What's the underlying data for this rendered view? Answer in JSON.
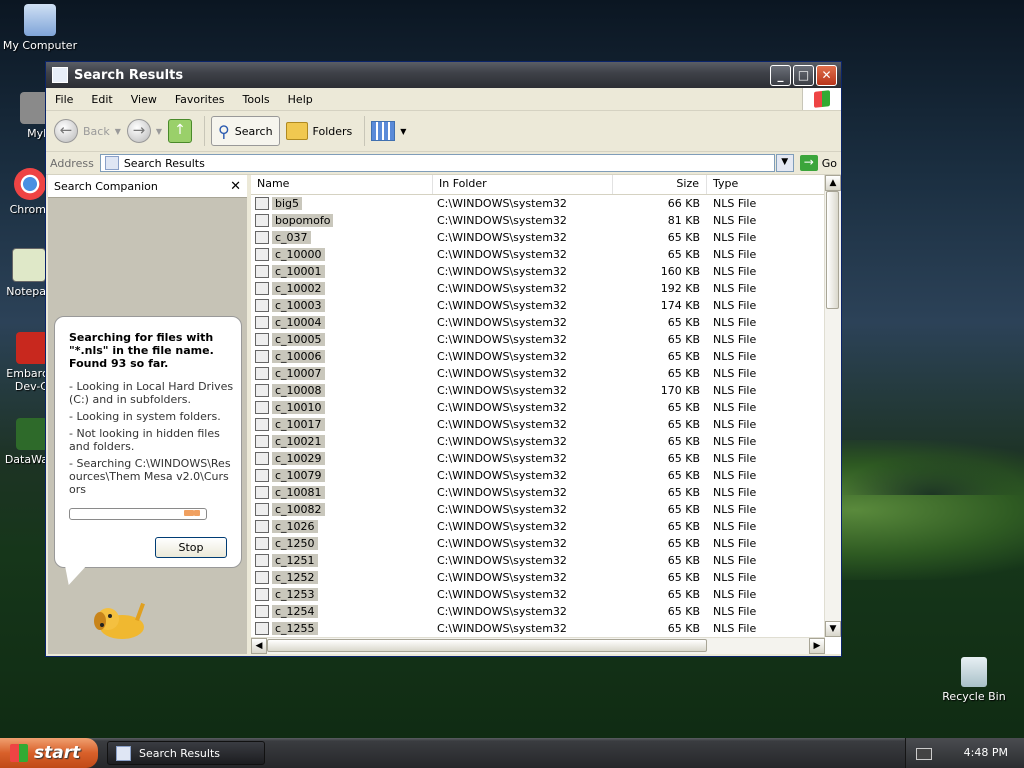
{
  "desktop": {
    "icons": [
      {
        "label": "My Computer"
      },
      {
        "label": "MyPa"
      },
      {
        "label": "Chrom"
      },
      {
        "label": "Notepa"
      },
      {
        "label": "Embarc Dev-C"
      },
      {
        "label": "DataWa"
      },
      {
        "label": "Recycle Bin"
      }
    ]
  },
  "window": {
    "title": "Search Results",
    "menu": [
      "File",
      "Edit",
      "View",
      "Favorites",
      "Tools",
      "Help"
    ],
    "toolbar": {
      "back": "Back",
      "search": "Search",
      "folders": "Folders"
    },
    "address": {
      "label": "Address",
      "value": "Search Results",
      "go": "Go"
    }
  },
  "companion": {
    "title": "Search Companion",
    "heading": "Searching for files with \"*.nls\" in the file name. Found 93 so far.",
    "lines": [
      "- Looking in Local Hard Drives (C:) and in subfolders.",
      "- Looking in system folders.",
      "- Not looking in hidden files and folders.",
      "- Searching C:\\WINDOWS\\Resources\\Them Mesa v2.0\\Cursors"
    ],
    "stop": "Stop"
  },
  "list": {
    "columns": [
      "Name",
      "In Folder",
      "Size",
      "Type"
    ],
    "rows": [
      {
        "name": "big5",
        "folder": "C:\\WINDOWS\\system32",
        "size": "66 KB",
        "type": "NLS File"
      },
      {
        "name": "bopomofo",
        "folder": "C:\\WINDOWS\\system32",
        "size": "81 KB",
        "type": "NLS File"
      },
      {
        "name": "c_037",
        "folder": "C:\\WINDOWS\\system32",
        "size": "65 KB",
        "type": "NLS File"
      },
      {
        "name": "c_10000",
        "folder": "C:\\WINDOWS\\system32",
        "size": "65 KB",
        "type": "NLS File"
      },
      {
        "name": "c_10001",
        "folder": "C:\\WINDOWS\\system32",
        "size": "160 KB",
        "type": "NLS File"
      },
      {
        "name": "c_10002",
        "folder": "C:\\WINDOWS\\system32",
        "size": "192 KB",
        "type": "NLS File"
      },
      {
        "name": "c_10003",
        "folder": "C:\\WINDOWS\\system32",
        "size": "174 KB",
        "type": "NLS File"
      },
      {
        "name": "c_10004",
        "folder": "C:\\WINDOWS\\system32",
        "size": "65 KB",
        "type": "NLS File"
      },
      {
        "name": "c_10005",
        "folder": "C:\\WINDOWS\\system32",
        "size": "65 KB",
        "type": "NLS File"
      },
      {
        "name": "c_10006",
        "folder": "C:\\WINDOWS\\system32",
        "size": "65 KB",
        "type": "NLS File"
      },
      {
        "name": "c_10007",
        "folder": "C:\\WINDOWS\\system32",
        "size": "65 KB",
        "type": "NLS File"
      },
      {
        "name": "c_10008",
        "folder": "C:\\WINDOWS\\system32",
        "size": "170 KB",
        "type": "NLS File"
      },
      {
        "name": "c_10010",
        "folder": "C:\\WINDOWS\\system32",
        "size": "65 KB",
        "type": "NLS File"
      },
      {
        "name": "c_10017",
        "folder": "C:\\WINDOWS\\system32",
        "size": "65 KB",
        "type": "NLS File"
      },
      {
        "name": "c_10021",
        "folder": "C:\\WINDOWS\\system32",
        "size": "65 KB",
        "type": "NLS File"
      },
      {
        "name": "c_10029",
        "folder": "C:\\WINDOWS\\system32",
        "size": "65 KB",
        "type": "NLS File"
      },
      {
        "name": "c_10079",
        "folder": "C:\\WINDOWS\\system32",
        "size": "65 KB",
        "type": "NLS File"
      },
      {
        "name": "c_10081",
        "folder": "C:\\WINDOWS\\system32",
        "size": "65 KB",
        "type": "NLS File"
      },
      {
        "name": "c_10082",
        "folder": "C:\\WINDOWS\\system32",
        "size": "65 KB",
        "type": "NLS File"
      },
      {
        "name": "c_1026",
        "folder": "C:\\WINDOWS\\system32",
        "size": "65 KB",
        "type": "NLS File"
      },
      {
        "name": "c_1250",
        "folder": "C:\\WINDOWS\\system32",
        "size": "65 KB",
        "type": "NLS File"
      },
      {
        "name": "c_1251",
        "folder": "C:\\WINDOWS\\system32",
        "size": "65 KB",
        "type": "NLS File"
      },
      {
        "name": "c_1252",
        "folder": "C:\\WINDOWS\\system32",
        "size": "65 KB",
        "type": "NLS File"
      },
      {
        "name": "c_1253",
        "folder": "C:\\WINDOWS\\system32",
        "size": "65 KB",
        "type": "NLS File"
      },
      {
        "name": "c_1254",
        "folder": "C:\\WINDOWS\\system32",
        "size": "65 KB",
        "type": "NLS File"
      },
      {
        "name": "c_1255",
        "folder": "C:\\WINDOWS\\system32",
        "size": "65 KB",
        "type": "NLS File"
      }
    ]
  },
  "taskbar": {
    "start": "start",
    "task": "Search Results",
    "clock": "4:48 PM"
  }
}
